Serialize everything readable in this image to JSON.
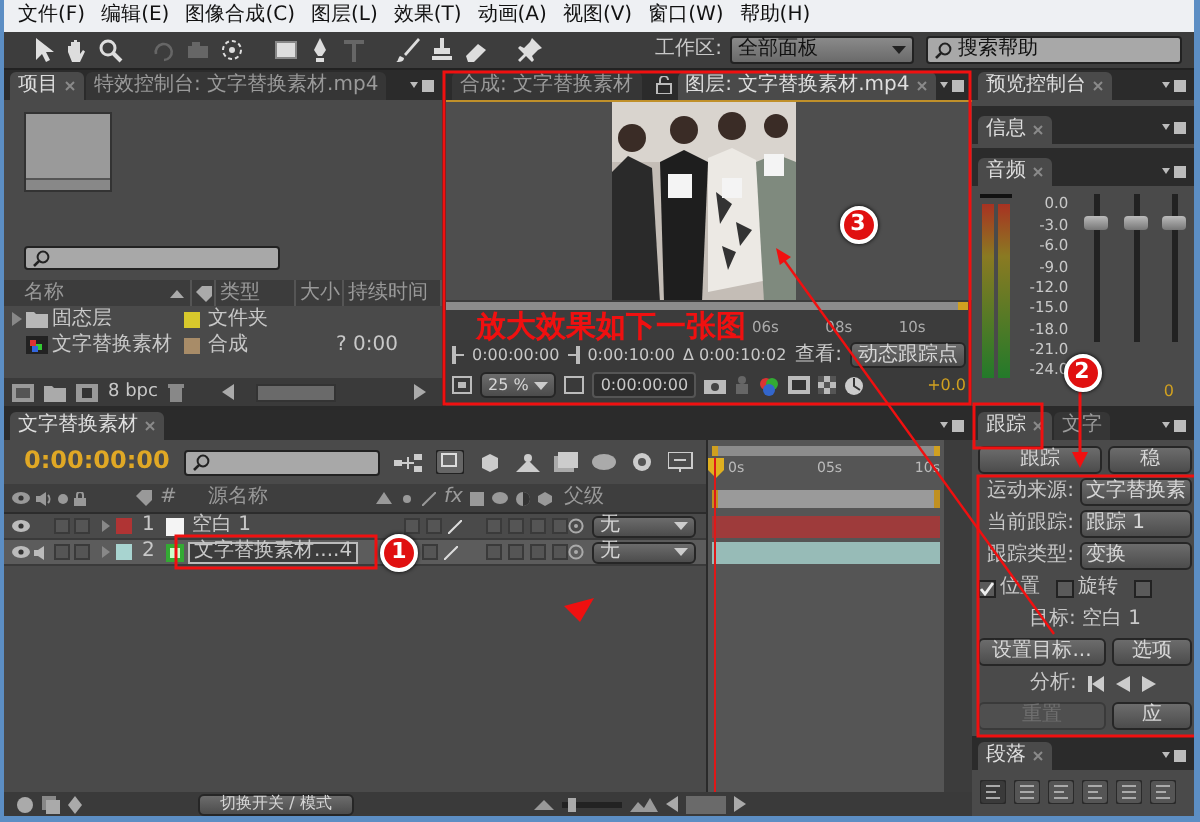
{
  "menu": [
    "文件(F)",
    "编辑(E)",
    "图像合成(C)",
    "图层(L)",
    "效果(T)",
    "动画(A)",
    "视图(V)",
    "窗口(W)",
    "帮助(H)"
  ],
  "toolbar": {
    "workspace_label": "工作区:",
    "workspace": "全部面板",
    "search_placeholder": "搜索帮助"
  },
  "project": {
    "tabs": [
      {
        "label": "项目",
        "selected": true
      },
      {
        "label": "特效控制台: 文字替换素材.mp4",
        "selected": false
      }
    ],
    "columns": [
      "名称",
      "类型",
      "大小",
      "持续时间"
    ],
    "items": [
      {
        "kind": "folder",
        "name": "固态层",
        "color": "#d8c82c",
        "type": "文件夹"
      },
      {
        "kind": "comp",
        "name": "文字替换素材",
        "color": "#a88c68",
        "type": "合成",
        "duration": "? 0:00"
      }
    ],
    "bit_depth": "8 bpc"
  },
  "viewer": {
    "tabs": [
      {
        "label": "合成: 文字替换素材",
        "selected": false
      },
      {
        "label": "图层: 文字替换素材.mp4",
        "selected": true
      }
    ],
    "ruler": [
      "06s",
      "08s",
      "10s"
    ],
    "in_point": "0:00:00:00",
    "out_point": "0:00:10:00",
    "duration": "Δ 0:00:10:02",
    "view_label": "查看:",
    "view": "动态跟踪点",
    "zoom": "25 %",
    "current_time": "0:00:00:00",
    "exposure": "+0.0"
  },
  "side_panels": [
    {
      "label": "预览控制台"
    },
    {
      "label": "信息"
    },
    {
      "label": "音频"
    }
  ],
  "audio": {
    "scale": [
      "0.0",
      "-3.0",
      "-6.0",
      "-9.0",
      "-12.0",
      "-15.0",
      "-18.0",
      "-21.0",
      "-24.0"
    ],
    "sliders": [
      {
        "level": 0.8
      },
      {
        "level": 0.8
      },
      {
        "level": 0.8
      }
    ],
    "readings": [
      "0"
    ]
  },
  "timeline": {
    "tab": "文字替换素材",
    "time": "0:00:00:00",
    "columns": {
      "number": "#",
      "source": "源名称",
      "effects": "fx",
      "parent": "父级"
    },
    "layers": [
      {
        "number": "1",
        "name": "空白 1",
        "kind": "solid",
        "color": "#b03434",
        "parent": "无",
        "selected": false
      },
      {
        "number": "2",
        "name": "文字替换素材....4",
        "kind": "footage",
        "color": "#a8d4d0",
        "parent": "无",
        "selected": true
      }
    ],
    "ruler": [
      "0s",
      "05s",
      "10s"
    ],
    "zoom": {
      "level": 0.1
    },
    "mode_button": "切换开关 / 模式"
  },
  "tracker": {
    "tabs": [
      {
        "label": "跟踪",
        "selected": true
      },
      {
        "label": "文字",
        "selected": false
      }
    ],
    "track_button": "跟踪",
    "stabilize_button": "稳",
    "fields": [
      {
        "label": "运动来源:",
        "value": "文字替换素"
      },
      {
        "label": "当前跟踪:",
        "value": "跟踪 1"
      },
      {
        "label": "跟踪类型:",
        "value": "变换"
      }
    ],
    "options": [
      {
        "label": "位置",
        "checked": true
      },
      {
        "label": "旋转",
        "checked": false
      },
      {
        "checked": false
      }
    ],
    "target": "目标: 空白 1",
    "set_target_button": "设置目标...",
    "options_button": "选项",
    "analyze_label": "分析:",
    "reset_button": {
      "label": "重置",
      "disabled": true
    },
    "apply_button": {
      "label": "应",
      "disabled": false
    }
  },
  "paragraph": {
    "tab": "段落"
  },
  "annotations": {
    "caption": "放大效果如下一张图",
    "badges": [
      "1",
      "2",
      "3"
    ]
  }
}
